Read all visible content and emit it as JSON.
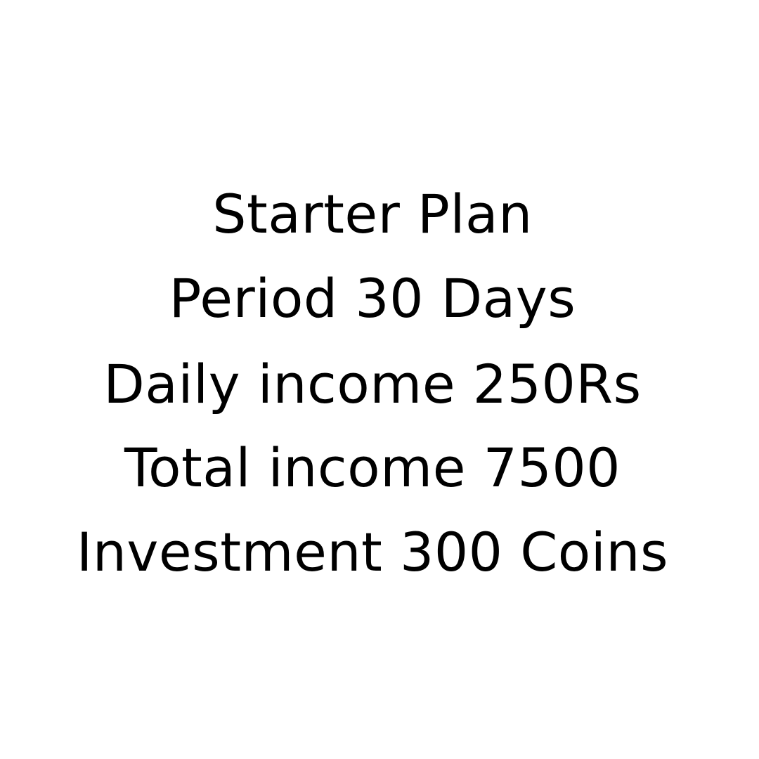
{
  "plan": {
    "lines": [
      "Starter Plan",
      "Period 30 Days",
      "Daily income 250Rs",
      "Total income 7500",
      "Investment 300 Coins"
    ]
  }
}
